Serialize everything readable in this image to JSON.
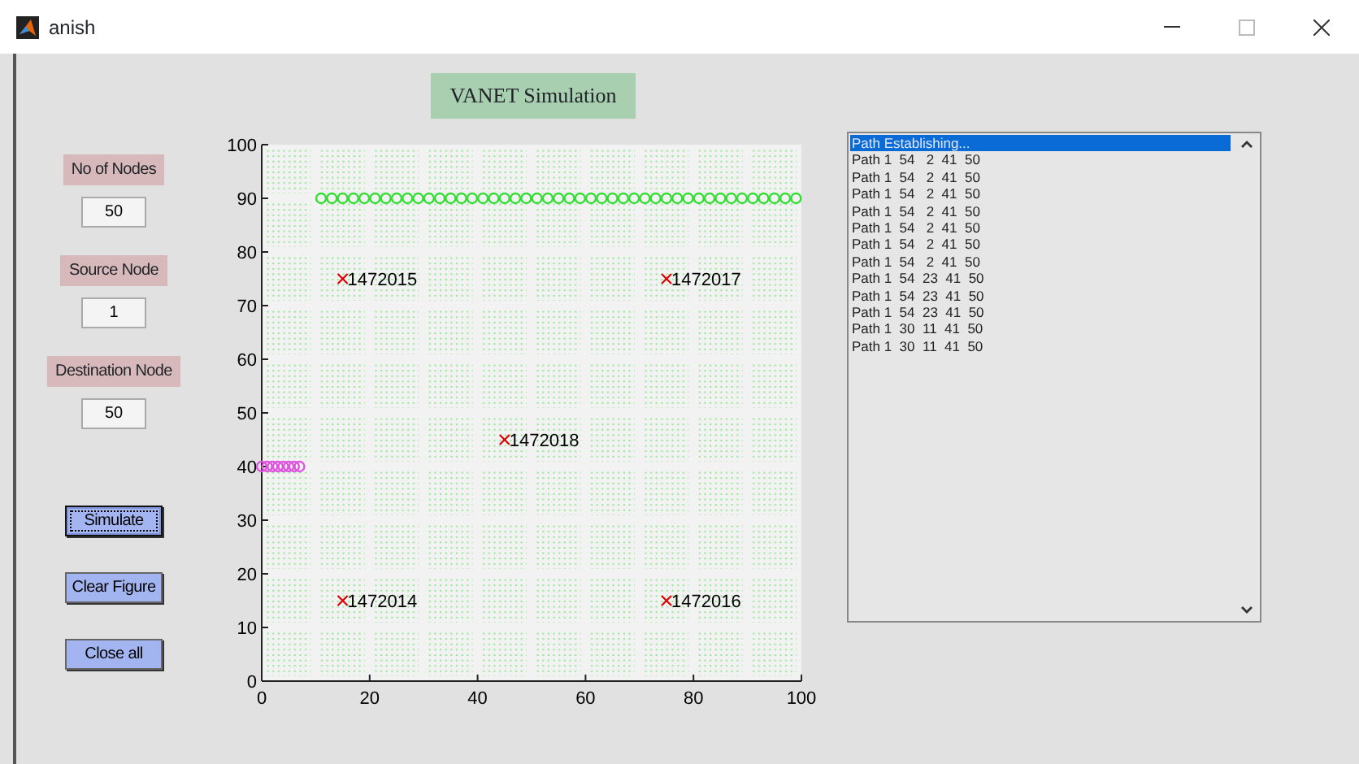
{
  "window": {
    "title": "anish"
  },
  "heading": "VANET Simulation",
  "fields": [
    {
      "label": "No of Nodes",
      "value": "50"
    },
    {
      "label": "Source Node",
      "value": "1"
    },
    {
      "label": "Destination Node",
      "value": "50"
    }
  ],
  "buttons": [
    {
      "label": "Simulate",
      "focused": true
    },
    {
      "label": "Clear Figure",
      "focused": false
    },
    {
      "label": "Close all",
      "focused": false
    }
  ],
  "plot": {
    "chart_data": {
      "type": "scatter",
      "xlim": [
        0,
        100
      ],
      "ylim": [
        0,
        100
      ],
      "xticks": [
        0,
        20,
        40,
        60,
        80,
        100
      ],
      "yticks": [
        0,
        10,
        20,
        30,
        40,
        50,
        60,
        70,
        80,
        90,
        100
      ],
      "series": [
        {
          "color": "#33dd33",
          "marker": "circle",
          "x": [
            11,
            13,
            15,
            17,
            19,
            21,
            23,
            25,
            27,
            29,
            31,
            33,
            35,
            37,
            39,
            41,
            43,
            45,
            47,
            49,
            51,
            53,
            55,
            57,
            59,
            61,
            63,
            65,
            67,
            69,
            71,
            73,
            75,
            77,
            79,
            81,
            83,
            85,
            87,
            89,
            91,
            93,
            95,
            97,
            99
          ],
          "values": [
            90,
            90,
            90,
            90,
            90,
            90,
            90,
            90,
            90,
            90,
            90,
            90,
            90,
            90,
            90,
            90,
            90,
            90,
            90,
            90,
            90,
            90,
            90,
            90,
            90,
            90,
            90,
            90,
            90,
            90,
            90,
            90,
            90,
            90,
            90,
            90,
            90,
            90,
            90,
            90,
            90,
            90,
            90,
            90,
            90
          ]
        },
        {
          "color": "#dd55dd",
          "marker": "circle",
          "x": [
            0,
            1,
            2,
            3,
            4,
            5,
            6,
            7
          ],
          "values": [
            40,
            40,
            40,
            40,
            40,
            40,
            40,
            40
          ]
        },
        {
          "color": "#dd0000",
          "marker": "cross",
          "x": [
            15,
            75,
            45,
            15,
            75
          ],
          "values": [
            75,
            75,
            45,
            15,
            15
          ]
        }
      ],
      "annotations": [
        {
          "x": 15,
          "y": 75,
          "text": "1472015"
        },
        {
          "x": 75,
          "y": 75,
          "text": "1472017"
        },
        {
          "x": 45,
          "y": 45,
          "text": "1472018"
        },
        {
          "x": 15,
          "y": 15,
          "text": "1472014"
        },
        {
          "x": 75,
          "y": 15,
          "text": "1472016"
        }
      ]
    }
  },
  "listbox": {
    "items": [
      {
        "text": "Path Establishing...",
        "selected": true
      },
      {
        "text": "Path 1  54   2  41  50",
        "selected": false
      },
      {
        "text": "Path 1  54   2  41  50",
        "selected": false
      },
      {
        "text": "Path 1  54   2  41  50",
        "selected": false
      },
      {
        "text": "Path 1  54   2  41  50",
        "selected": false
      },
      {
        "text": "Path 1  54   2  41  50",
        "selected": false
      },
      {
        "text": "Path 1  54   2  41  50",
        "selected": false
      },
      {
        "text": "Path 1  54   2  41  50",
        "selected": false
      },
      {
        "text": "Path 1  54  23  41  50",
        "selected": false
      },
      {
        "text": "Path 1  54  23  41  50",
        "selected": false
      },
      {
        "text": "Path 1  54  23  41  50",
        "selected": false
      },
      {
        "text": "Path 1  30  11  41  50",
        "selected": false
      },
      {
        "text": "Path 1  30  11  41  50",
        "selected": false
      }
    ]
  }
}
